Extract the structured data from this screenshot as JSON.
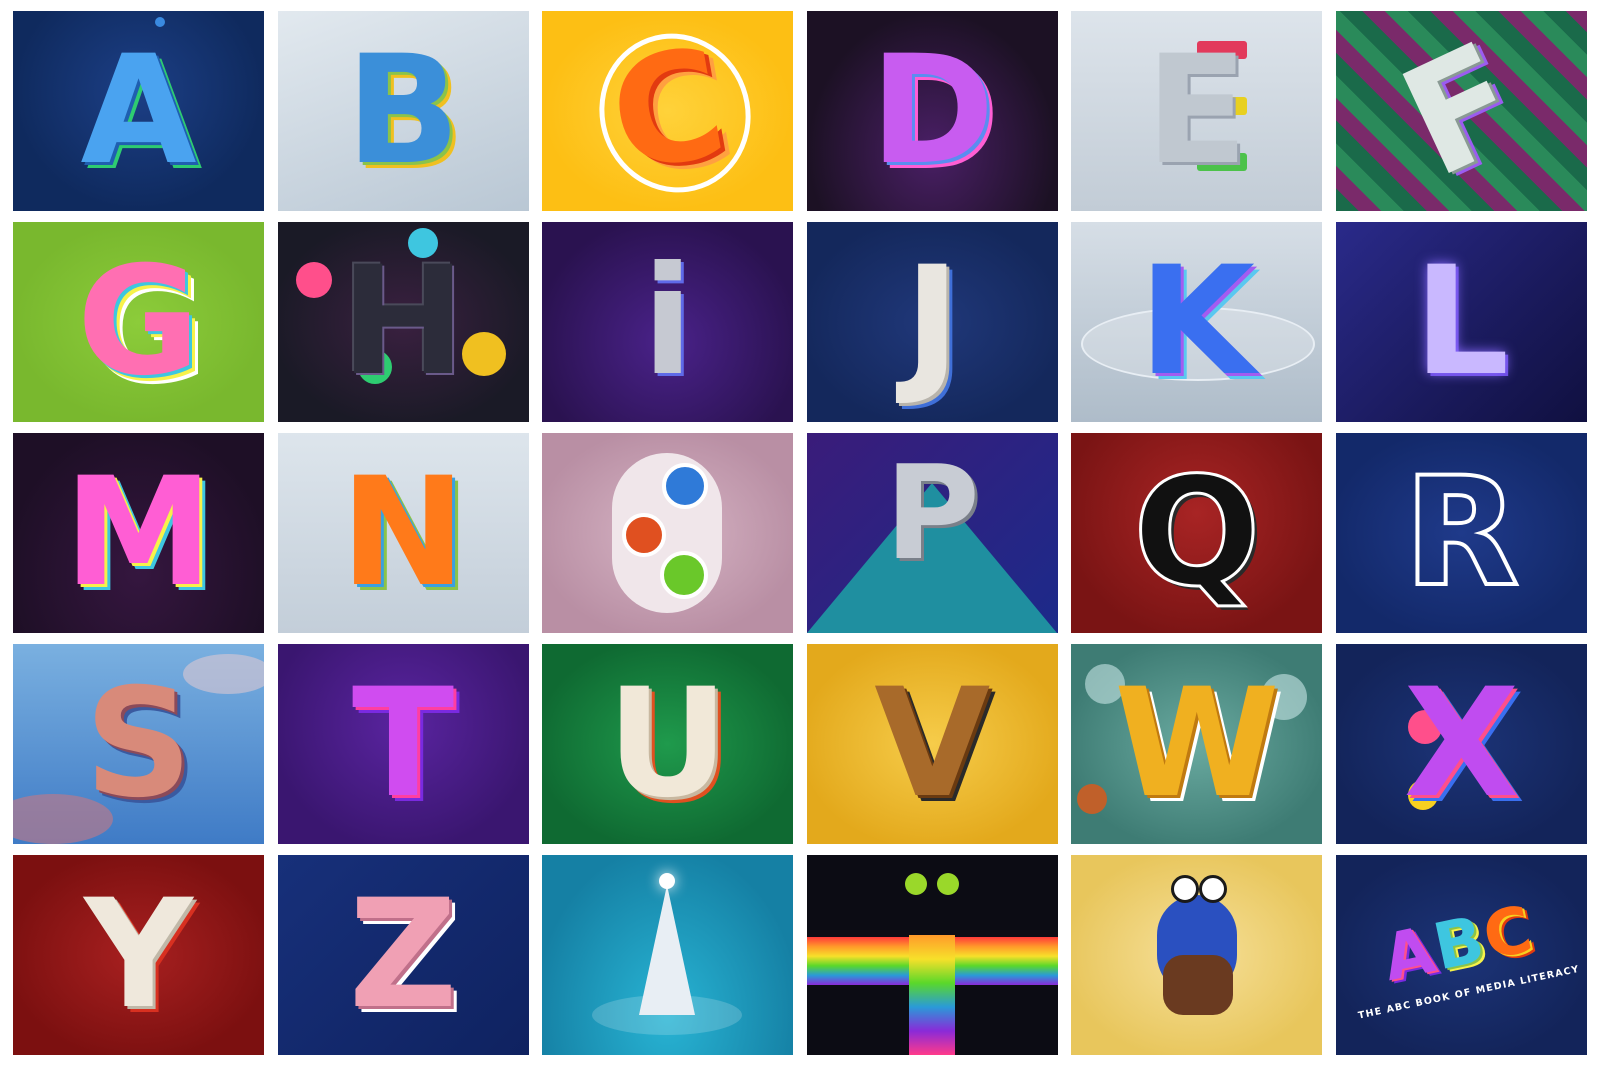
{
  "tagline": "THE ABC BOOK OF MEDIA LITERACY",
  "tiles": [
    {
      "name": "a",
      "letter": "A",
      "bg": "#0f2a5e",
      "bg2": "#1c3f86",
      "fg": "#4aa3f0",
      "accent": "#2ecc71"
    },
    {
      "name": "b",
      "letter": "B",
      "bg": "#d4dde6",
      "bg2": "#b9c7d4",
      "fg": "#3b8fd9",
      "accent": "#8bc34a"
    },
    {
      "name": "c",
      "letter": "C",
      "bg": "#fdbf14",
      "bg2": "#f5a623",
      "fg": "#ff6a13",
      "accent": "#ffffff"
    },
    {
      "name": "d",
      "letter": "D",
      "bg": "#1c1124",
      "bg2": "#3a1d4e",
      "fg": "#c85cf0",
      "accent": "#5b8df0"
    },
    {
      "name": "e",
      "letter": "E",
      "bg": "#d8e0e8",
      "bg2": "#c2ccd6",
      "fg": "#c0c8d0",
      "accent": "#e23a5c"
    },
    {
      "name": "f",
      "letter": "F",
      "bg": "#1a6a4a",
      "bg2": "#7a2a6a",
      "fg": "#dfe8e4",
      "accent": "#9b5cf0"
    },
    {
      "name": "g",
      "letter": "G",
      "bg": "#79b82e",
      "bg2": "#6aa524",
      "fg": "#ff6fb2",
      "accent": "#3ec6e0"
    },
    {
      "name": "h",
      "letter": "H",
      "bg": "#1a1a26",
      "bg2": "#3a2040",
      "fg": "#2c2c3a",
      "accent": "#ff4f8b"
    },
    {
      "name": "i",
      "letter": "i",
      "bg": "#2a1250",
      "bg2": "#3e1c72",
      "fg": "#c6c9d2",
      "accent": "#5f6ae8"
    },
    {
      "name": "j",
      "letter": "J",
      "bg": "#14285c",
      "bg2": "#20387a",
      "fg": "#e9e6e0",
      "accent": "#3f6fd8"
    },
    {
      "name": "k",
      "letter": "K",
      "bg": "#c9d3dd",
      "bg2": "#aebcc9",
      "fg": "#3a6ff0",
      "accent": "#a35cf0"
    },
    {
      "name": "l",
      "letter": "L",
      "bg": "#1a1a5c",
      "bg2": "#2a2a8a",
      "fg": "#c9b8ff",
      "accent": "#ffffff"
    },
    {
      "name": "m",
      "letter": "M",
      "bg": "#1e0f26",
      "bg2": "#35163f",
      "fg": "#ff5ed4",
      "accent": "#f7f24a"
    },
    {
      "name": "n",
      "letter": "N",
      "bg": "#d7e0e8",
      "bg2": "#c3ced9",
      "fg": "#ff7a1a",
      "accent": "#3aa0e0"
    },
    {
      "name": "o",
      "letter": "O",
      "bg": "#cba6b8",
      "bg2": "#b98fa4",
      "fg": "#f0e6ea",
      "accent": "#2f7ad8"
    },
    {
      "name": "p",
      "letter": "P",
      "bg": "#1c2a8a",
      "bg2": "#3a1c7a",
      "fg": "#c8ccd4",
      "accent": "#1f8fa0"
    },
    {
      "name": "q",
      "letter": "Q",
      "bg": "#941c1c",
      "bg2": "#7a1414",
      "fg": "#111111",
      "accent": "#ffffff"
    },
    {
      "name": "r",
      "letter": "R",
      "bg": "#13296a",
      "bg2": "#1f3a8a",
      "fg": "#ffffff",
      "accent": "#9aa3b0"
    },
    {
      "name": "s",
      "letter": "S",
      "bg": "#3f7bc6",
      "bg2": "#7ab0e0",
      "fg": "#d88a7a",
      "accent": "#8a2a2a"
    },
    {
      "name": "t",
      "letter": "T",
      "bg": "#4a1c8a",
      "bg2": "#3a1670",
      "fg": "#d04cf0",
      "accent": "#ff3fa0"
    },
    {
      "name": "u",
      "letter": "U",
      "bg": "#17843f",
      "bg2": "#0f6a32",
      "fg": "#f1e8d8",
      "accent": "#e05020"
    },
    {
      "name": "v",
      "letter": "V",
      "bg": "#f1c02c",
      "bg2": "#e3a91c",
      "fg": "#a86a2a",
      "accent": "#2a2a2a"
    },
    {
      "name": "w",
      "letter": "W",
      "bg": "#5a9a90",
      "bg2": "#3e7c74",
      "fg": "#f0b020",
      "accent": "#ffffff"
    },
    {
      "name": "x",
      "letter": "X",
      "bg": "#13245a",
      "bg2": "#1c3478",
      "fg": "#c04cf0",
      "accent": "#ff4f8b"
    },
    {
      "name": "y",
      "letter": "Y",
      "bg": "#981818",
      "bg2": "#7c1010",
      "fg": "#efe8dc",
      "accent": "#d83020"
    },
    {
      "name": "z",
      "letter": "Z",
      "bg": "#17307a",
      "bg2": "#0f2260",
      "fg": "#f0a0b4",
      "accent": "#3a5cd8"
    },
    {
      "name": "lighthouse",
      "letter": "",
      "bg": "#1ea0c0",
      "bg2": "#1580a4",
      "fg": "#e8eef4",
      "accent": "#2a5ad8"
    },
    {
      "name": "rainbow",
      "letter": "",
      "bg": "#0c0c14",
      "bg2": "#1a1a26",
      "fg": "#ff5a3a",
      "accent": "#9ad82a"
    },
    {
      "name": "character",
      "letter": "",
      "bg": "#f2d57a",
      "bg2": "#e8c65c",
      "fg": "#2a50c0",
      "accent": "#6a3a20"
    },
    {
      "name": "abc-cover",
      "letter": "",
      "bg": "#13245a",
      "bg2": "#1c3478",
      "fg": "#ffffff",
      "accent": "#c04cf0"
    }
  ]
}
